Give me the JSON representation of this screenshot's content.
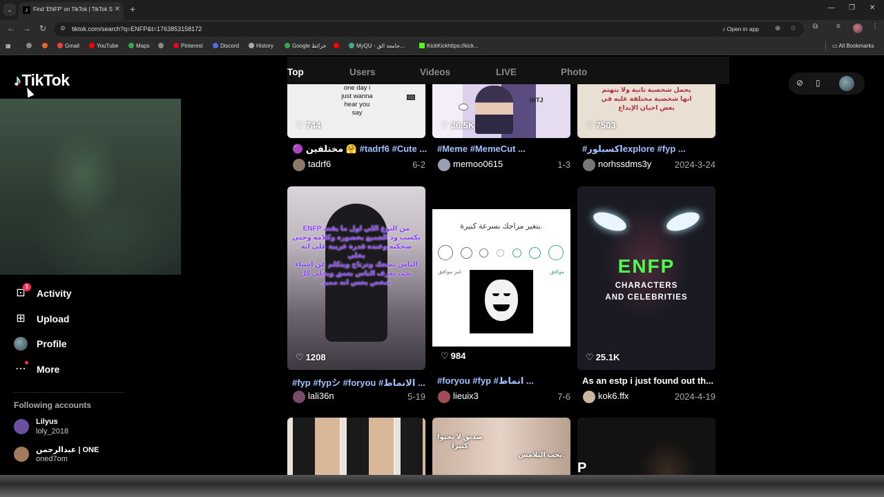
{
  "browser": {
    "tab_title": "Find 'ENFP' on TikTok | TikTok S",
    "tab_close": "✕",
    "new_tab": "+",
    "url": "tiktok.com/search?q=ENFP&t=1763853158172",
    "open_in_app": "Open in app",
    "window_controls": [
      "—",
      "❐",
      "✕"
    ],
    "bookmarks": [
      {
        "label": "",
        "icon_color": "#888"
      },
      {
        "label": "",
        "icon_color": "#e8682a"
      },
      {
        "label": "Gmail",
        "icon_color": "#ea4335"
      },
      {
        "label": "YouTube",
        "icon_color": "#ff0000"
      },
      {
        "label": "Maps",
        "icon_color": "#34a853"
      },
      {
        "label": "",
        "icon_color": "#888"
      },
      {
        "label": "Pinterest",
        "icon_color": "#e60023"
      },
      {
        "label": "Discord",
        "icon_color": "#5865f2"
      },
      {
        "label": "History",
        "icon_color": "#aaa"
      },
      {
        "label": "Google خرائط",
        "icon_color": "#34a853"
      },
      {
        "label": "",
        "icon_color": "#ff0000"
      },
      {
        "label": "MyQU - جامعة الق...",
        "icon_color": "#4a8"
      },
      {
        "label": "KickKickhttps://kick...",
        "icon_color": "#53fc18"
      }
    ],
    "all_bookmarks": "All Bookmarks"
  },
  "sidebar": {
    "logo": "TikTok",
    "items": [
      {
        "label": "Activity",
        "icon": "inbox-icon",
        "badge": "1"
      },
      {
        "label": "Upload",
        "icon": "plus-square-icon"
      },
      {
        "label": "Profile",
        "icon": "avatar"
      },
      {
        "label": "More",
        "icon": "more-dots-icon"
      }
    ],
    "following_header": "Following accounts",
    "accounts": [
      {
        "name": "Lilyus",
        "handle": "loly_2018",
        "color": "#6b4fa0"
      },
      {
        "name": "عبدالرحمن | ONE",
        "handle": "oned7om",
        "color": "#a57a5a"
      }
    ]
  },
  "search_tabs": [
    "Top",
    "Users",
    "Videos",
    "LIVE",
    "Photo"
  ],
  "videos": [
    {
      "likes": "744",
      "caption_plain": "مختلفين 🤗 ",
      "caption_tags": "#tadrf6 #Cute ...",
      "user": "tadrf6",
      "date": "6-2",
      "overlay": "one day i\njust wanna\nhear you\nsay"
    },
    {
      "likes": "36.5K",
      "caption_plain": "",
      "caption_tags": "#Meme #MemeCut ...",
      "user": "memoo0615",
      "date": "1-3",
      "overlay": "INTJ"
    },
    {
      "likes": "7503",
      "caption_plain": "",
      "caption_tags": "#اكسبلورexplore #fyp ...",
      "user": "norhssdms3y",
      "date": "2024-3-24",
      "overlay": "يحمل شخصية تانية ولا بتهتم\nانها شخصية مختلفة عليه في\nبعض احيان الإبداع"
    },
    {
      "likes": "1208",
      "caption_plain": "",
      "caption_tags": "#fyp #fypシ #foryou #الانماط ...",
      "user": "lali36n",
      "date": "5-19",
      "overlay": "ENFP من النوع اللي اول ما يقعد\nيكسب ود الجميع بحضوره وكلامه وحتى\nضحكته وعنده قدرة غريبة على انه يخلي\nالناس تضحك وترتاح ويتكلم عن اشياء\nيحب يعرف الناس بعمق ويخلي كل\nشخص يحس انه مميز"
    },
    {
      "likes": "984",
      "caption_plain": "",
      "caption_tags": "#foryou #fyp #انماط ...",
      "user": "lieuix3",
      "date": "7-6",
      "overlay": "يتغير مزاجك بسرعة كبيرة.",
      "agree": "موافق",
      "disagree": "غير موافق"
    },
    {
      "likes": "25.1K",
      "caption_plain": "As an estp i just found out th...",
      "caption_tags": "",
      "user": "kok6.ffx",
      "date": "2024-4-19",
      "overlay_title": "ENFP",
      "overlay_sub": "CHARACTERS\nAND CELEBRITIES"
    }
  ],
  "bottom_row_overlays": [
    "صديق لا يحبوا كثيرا",
    "يحب التلامس:"
  ]
}
